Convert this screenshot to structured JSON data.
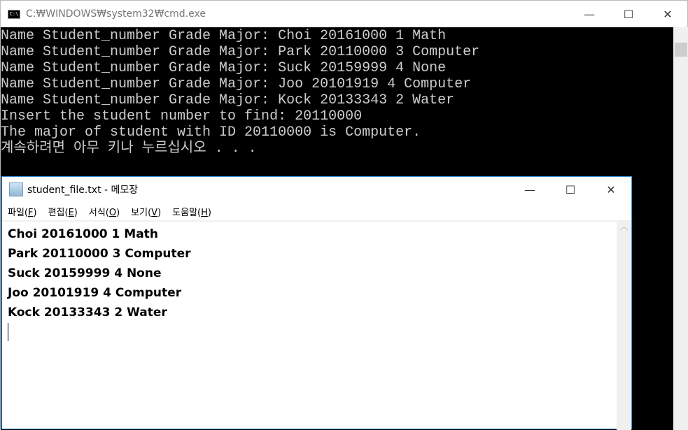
{
  "cmd": {
    "title": "C:₩WINDOWS₩system32₩cmd.exe",
    "icon": "cmd-icon",
    "lines": [
      "Name Student_number Grade Major: Choi 20161000 1 Math",
      "Name Student_number Grade Major: Park 20110000 3 Computer",
      "Name Student_number Grade Major: Suck 20159999 4 None",
      "Name Student_number Grade Major: Joo 20101919 4 Computer",
      "Name Student_number Grade Major: Kock 20133343 2 Water",
      "Insert the student number to find: 20110000",
      "The major of student with ID 20110000 is Computer.",
      "계속하려면 아무 키나 누르십시오 . . ."
    ]
  },
  "notepad": {
    "title": "student_file.txt - 메모장",
    "icon": "notepad-icon",
    "menu": [
      {
        "label": "파일(",
        "key": "F",
        "end": ")"
      },
      {
        "label": "편집(",
        "key": "E",
        "end": ")"
      },
      {
        "label": "서식(",
        "key": "O",
        "end": ")"
      },
      {
        "label": "보기(",
        "key": "V",
        "end": ")"
      },
      {
        "label": "도움말(",
        "key": "H",
        "end": ")"
      }
    ],
    "lines": [
      "Choi 20161000 1 Math",
      "Park 20110000 3 Computer",
      "Suck 20159999 4 None",
      "Joo 20101919 4 Computer",
      "Kock 20133343 2 Water"
    ]
  },
  "buttons": {
    "minimize": "—",
    "maximize": "☐",
    "close": "✕"
  }
}
